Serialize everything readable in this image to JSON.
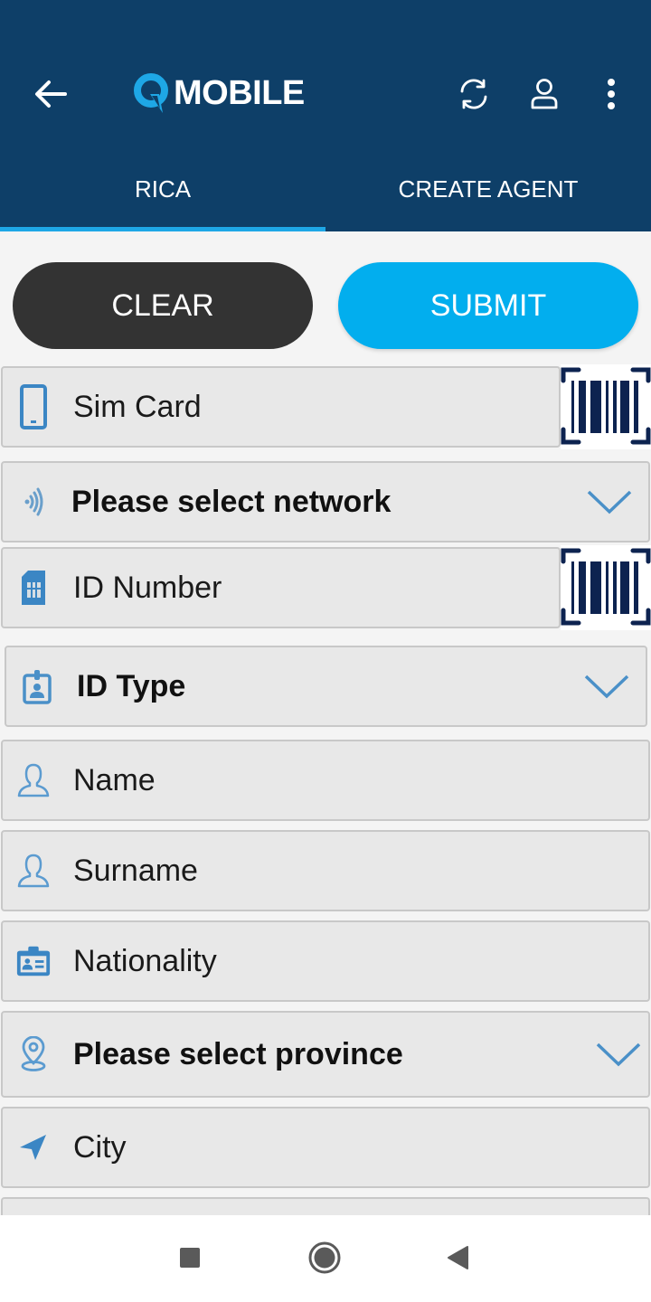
{
  "app": {
    "brand_name": "MOBILE",
    "colors": {
      "header_bg": "#0e3f68",
      "accent": "#02aeee",
      "clear_button": "#333333",
      "field_bg": "#e8e8e8",
      "icon_blue": "#3b86c4",
      "barcode_navy": "#0d2350"
    }
  },
  "header": {
    "back_icon": "arrow-left-icon",
    "logo_icon": "q-logo-icon",
    "actions": [
      {
        "name": "refresh",
        "icon": "refresh-icon"
      },
      {
        "name": "profile",
        "icon": "user-icon"
      },
      {
        "name": "more",
        "icon": "more-vertical-icon"
      }
    ]
  },
  "tabs": [
    {
      "label": "RICA",
      "active": true
    },
    {
      "label": "CREATE AGENT",
      "active": false
    }
  ],
  "actions": {
    "clear_label": "CLEAR",
    "submit_label": "SUBMIT"
  },
  "form": {
    "fields": [
      {
        "key": "sim_card",
        "label": "Sim Card",
        "icon": "phone-icon",
        "type": "input",
        "scan": true
      },
      {
        "key": "network",
        "label": "Please select network",
        "icon": "signal-icon",
        "type": "select"
      },
      {
        "key": "id_number",
        "label": "ID Number",
        "icon": "sim-card-icon",
        "type": "input",
        "scan": true
      },
      {
        "key": "id_type",
        "label": "ID Type",
        "icon": "id-badge-icon",
        "type": "select"
      },
      {
        "key": "name",
        "label": "Name",
        "icon": "person-icon",
        "type": "input"
      },
      {
        "key": "surname",
        "label": "Surname",
        "icon": "person-icon",
        "type": "input"
      },
      {
        "key": "nationality",
        "label": "Nationality",
        "icon": "id-card-icon",
        "type": "input"
      },
      {
        "key": "province",
        "label": "Please select province",
        "icon": "location-pin-icon",
        "type": "select"
      },
      {
        "key": "city",
        "label": "City",
        "icon": "navigation-arrow-icon",
        "type": "input"
      }
    ]
  },
  "system_nav": {
    "recent": "square-icon",
    "home": "circle-icon",
    "back": "triangle-back-icon"
  }
}
